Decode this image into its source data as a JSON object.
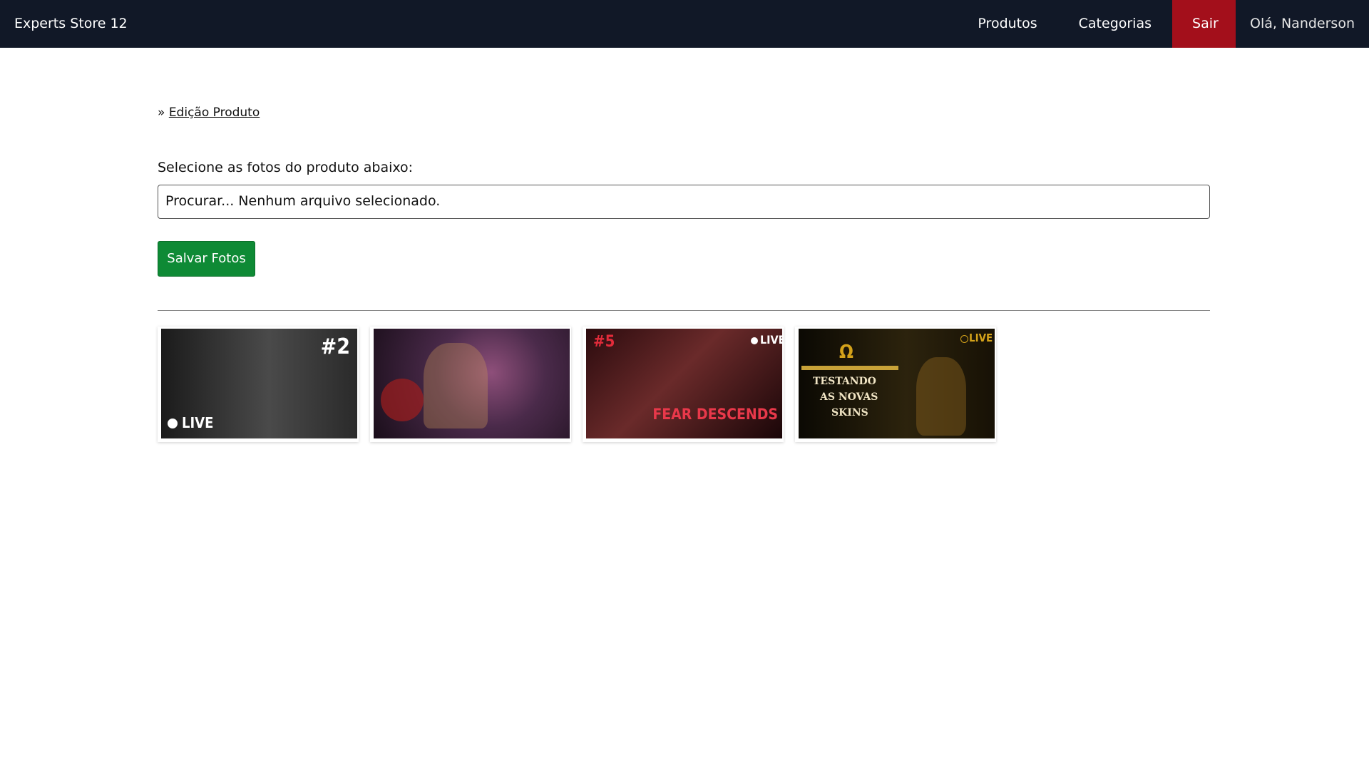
{
  "nav": {
    "brand": "Experts Store 12",
    "items": [
      "Produtos",
      "Categorias"
    ],
    "logout": "Sair",
    "greeting": "Olá, Nanderson"
  },
  "breadcrumb": {
    "separator": "»",
    "link": "Edição Produto"
  },
  "form": {
    "label": "Selecione as fotos do produto abaixo:",
    "file_value": "Procurar... Nenhum arquivo selecionado.",
    "save_label": "Salvar Fotos"
  },
  "gallery": {
    "thumbs": [
      {
        "overlay_top": "#2",
        "overlay_bottom": "LIVE"
      },
      {},
      {
        "overlay_top": "#5",
        "overlay_live": "LIVE",
        "overlay_bottom": "FEAR DESCENDS"
      },
      {
        "overlay_symbol": "Ω",
        "overlay_live": "LIVE",
        "overlay_line1": "TESTANDO",
        "overlay_line2": "AS NOVAS",
        "overlay_line3": "SKINS"
      }
    ]
  },
  "colors": {
    "navbar": "#111827",
    "logout": "#a30f1b",
    "save_button": "#0e8a35"
  }
}
